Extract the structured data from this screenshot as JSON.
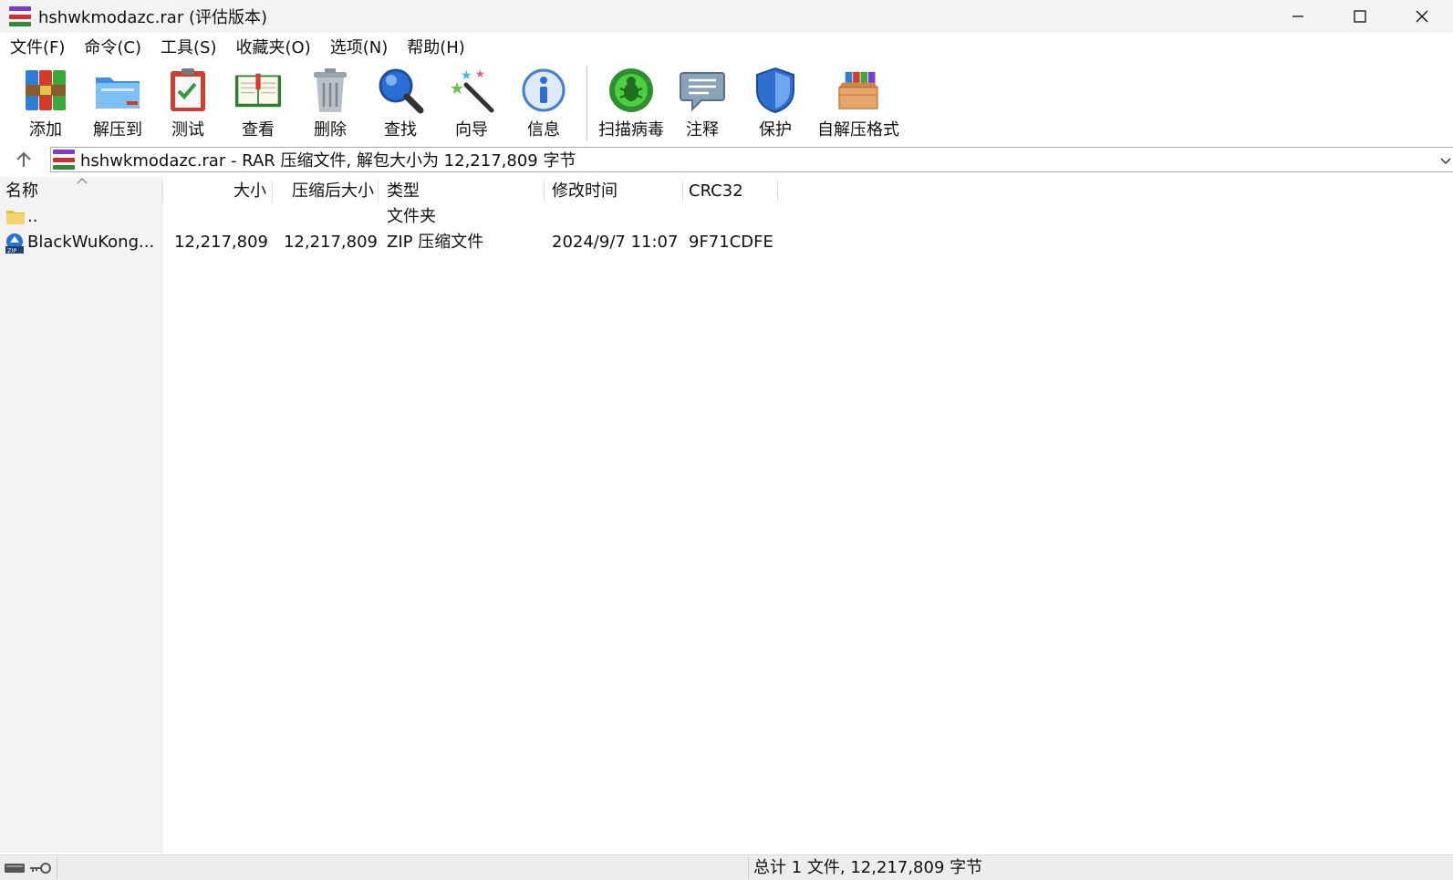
{
  "window": {
    "title": "hshwkmodazc.rar (评估版本)",
    "controls": {
      "minimize": "minimize",
      "maximize": "maximize",
      "close": "close"
    }
  },
  "menu": [
    "文件(F)",
    "命令(C)",
    "工具(S)",
    "收藏夹(O)",
    "选项(N)",
    "帮助(H)"
  ],
  "toolbar": {
    "add": "添加",
    "extract_to": "解压到",
    "test": "测试",
    "view": "查看",
    "delete": "删除",
    "find": "查找",
    "wizard": "向导",
    "info": "信息",
    "virus_scan": "扫描病毒",
    "comment": "注释",
    "protect": "保护",
    "sfx": "自解压格式"
  },
  "address": {
    "text": "hshwkmodazc.rar - RAR 压缩文件, 解包大小为 12,217,809 字节"
  },
  "columns": {
    "name": "名称",
    "size": "大小",
    "packed": "压缩后大小",
    "type": "类型",
    "modified": "修改时间",
    "crc": "CRC32"
  },
  "rows": [
    {
      "name": "..",
      "size": "",
      "packed": "",
      "type": "文件夹",
      "modified": "",
      "crc": ""
    },
    {
      "name": "BlackWuKong...",
      "size": "12,217,809",
      "packed": "12,217,809",
      "type": "ZIP 压缩文件",
      "modified": "2024/9/7 11:07",
      "crc": "9F71CDFE"
    }
  ],
  "status": {
    "summary": "总计 1 文件, 12,217,809 字节"
  },
  "colors": {
    "titlebar": "#f3f3f3",
    "leftpane": "#f3f3f3",
    "statusbar": "#ededed"
  }
}
